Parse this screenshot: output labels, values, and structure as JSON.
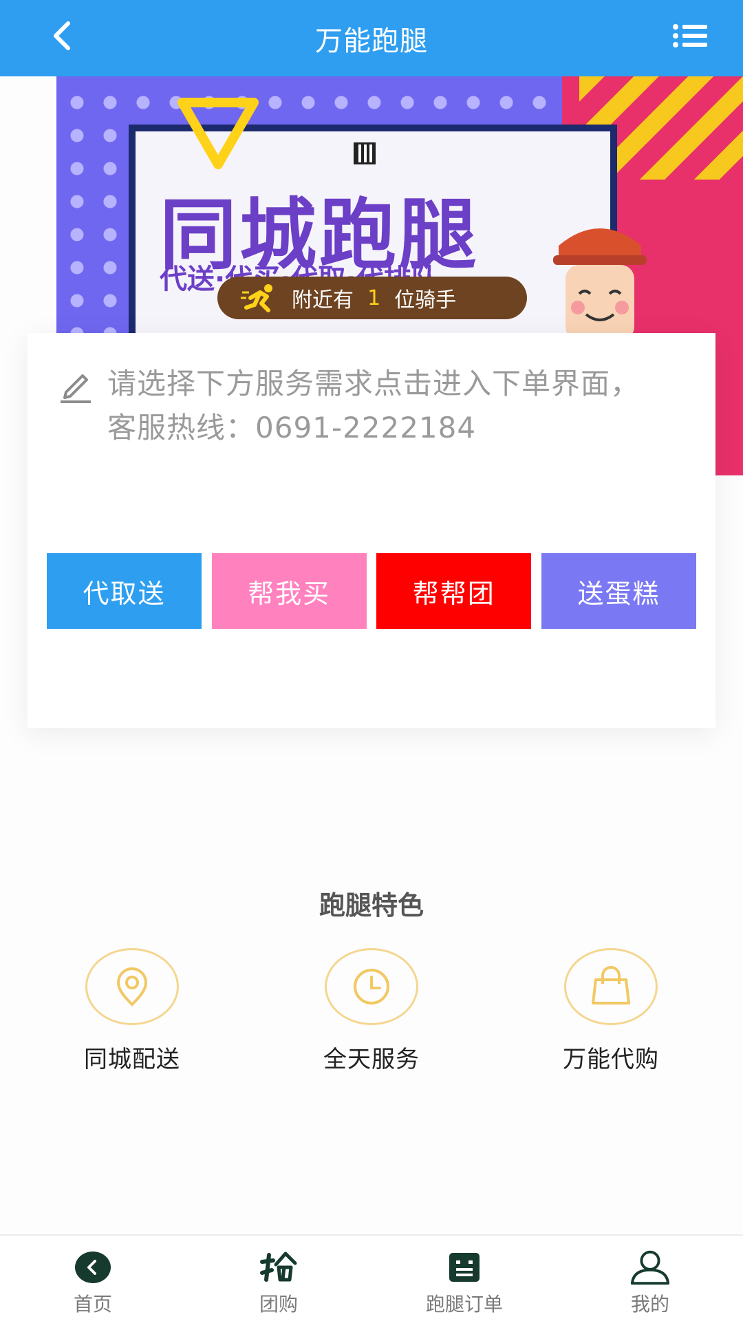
{
  "header": {
    "title": "万能跑腿",
    "back_icon": "chevron-left-icon",
    "menu_icon": "list-menu-icon"
  },
  "banner": {
    "headline": "同城跑腿",
    "subline": "代送·代买·代取·代排队",
    "nearby": {
      "prefix": "附近有",
      "count": "1",
      "suffix": "位骑手"
    }
  },
  "order_card": {
    "notice": "请选择下方服务需求点击进入下单界面，客服热线：0691-2222184",
    "services": [
      {
        "label": "代取送",
        "color": "#2e9ef0"
      },
      {
        "label": "帮我买",
        "color": "#ff82bf"
      },
      {
        "label": "帮帮团",
        "color": "#ff0000"
      },
      {
        "label": "送蛋糕",
        "color": "#7b78f4"
      }
    ]
  },
  "features": {
    "title": "跑腿特色",
    "items": [
      {
        "label": "同城配送",
        "icon": "location-pin-icon"
      },
      {
        "label": "全天服务",
        "icon": "clock-icon"
      },
      {
        "label": "万能代购",
        "icon": "shopping-bag-icon"
      }
    ]
  },
  "tabbar": {
    "items": [
      {
        "label": "首页",
        "icon": "back-circle-icon"
      },
      {
        "label": "团购",
        "icon": "grab-icon"
      },
      {
        "label": "跑腿订单",
        "icon": "order-list-icon"
      },
      {
        "label": "我的",
        "icon": "user-icon"
      }
    ]
  },
  "colors": {
    "header": "#2f9ef0",
    "accent_gold": "#f4d68e"
  }
}
